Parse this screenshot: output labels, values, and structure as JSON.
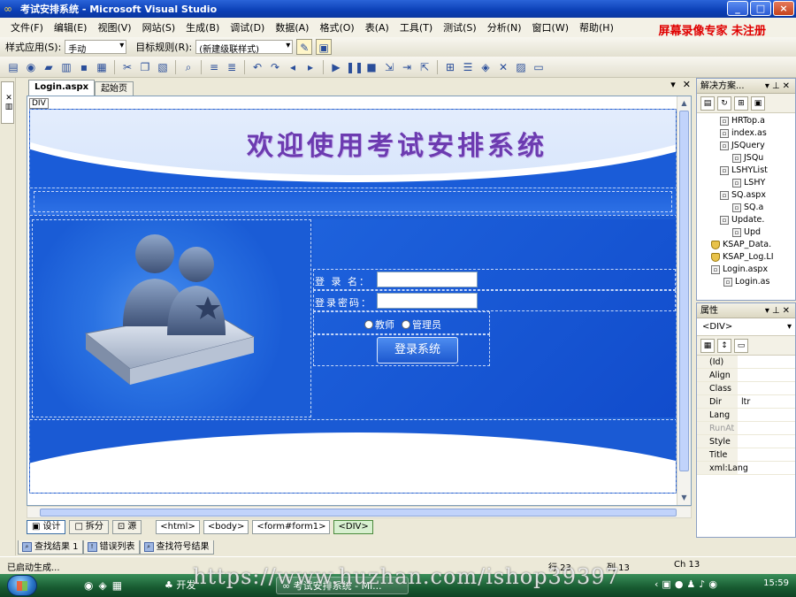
{
  "window": {
    "title": "考试安排系统 - Microsoft Visual Studio",
    "controls": [
      "_",
      "□",
      "×"
    ]
  },
  "menu": [
    "文件(F)",
    "编辑(E)",
    "视图(V)",
    "网站(S)",
    "生成(B)",
    "调试(D)",
    "数据(A)",
    "格式(O)",
    "表(A)",
    "工具(T)",
    "测试(S)",
    "分析(N)",
    "窗口(W)",
    "帮助(H)"
  ],
  "watermark_top": "屏幕录像专家 未注册",
  "toolbar1": {
    "style_apply_label": "样式应用(S):",
    "style_apply_value": "手动",
    "target_rule_label": "目标规则(R):",
    "target_rule_value": "(新建级联样式)"
  },
  "doc_tabs": [
    "Login.aspx",
    "起始页"
  ],
  "designer": {
    "div_tag": "DIV",
    "banner_title": "欢迎使用考试安排系统",
    "form": {
      "login_name_label": "登 录 名：",
      "password_label": "登录密码：",
      "radio_teacher": "教师",
      "radio_admin": "管理员",
      "login_button": "登录系统"
    }
  },
  "view_tabs": [
    "设计",
    "拆分",
    "源"
  ],
  "breadcrumbs": [
    "<html>",
    "<body>",
    "<form#form1>",
    "<DIV>"
  ],
  "output_tabs": [
    "查找结果 1",
    "错误列表",
    "查找符号结果"
  ],
  "solution_explorer": {
    "title": "解决方案...",
    "items": [
      "HRTop.a",
      "index.as",
      "JSQuery",
      "JSQu",
      "LSHYList",
      "LSHY",
      "SQ.aspx",
      "SQ.a",
      "Update.",
      "Upd",
      "KSAP_Data.",
      "KSAP_Log.LI",
      "Login.aspx",
      "Login.as"
    ]
  },
  "properties": {
    "title": "属性",
    "selected": "<DIV>",
    "rows": [
      {
        "name": "(Id)",
        "value": ""
      },
      {
        "name": "Align",
        "value": ""
      },
      {
        "name": "Class",
        "value": ""
      },
      {
        "name": "Dir",
        "value": "ltr"
      },
      {
        "name": "Lang",
        "value": ""
      },
      {
        "name": "RunAt",
        "value": ""
      },
      {
        "name": "Style",
        "value": ""
      },
      {
        "name": "Title",
        "value": ""
      },
      {
        "name": "xml:Lang",
        "value": ""
      }
    ]
  },
  "statusbar": {
    "message": "已启动生成...",
    "line": "行 23",
    "col": "列 13",
    "ch": "Ch 13"
  },
  "taskbar": {
    "task1": "开发",
    "task2": "考试安排系统 - Mi...",
    "clock": "15:59"
  },
  "watermark_url": "https://www.huzhan.com/ishop39397"
}
